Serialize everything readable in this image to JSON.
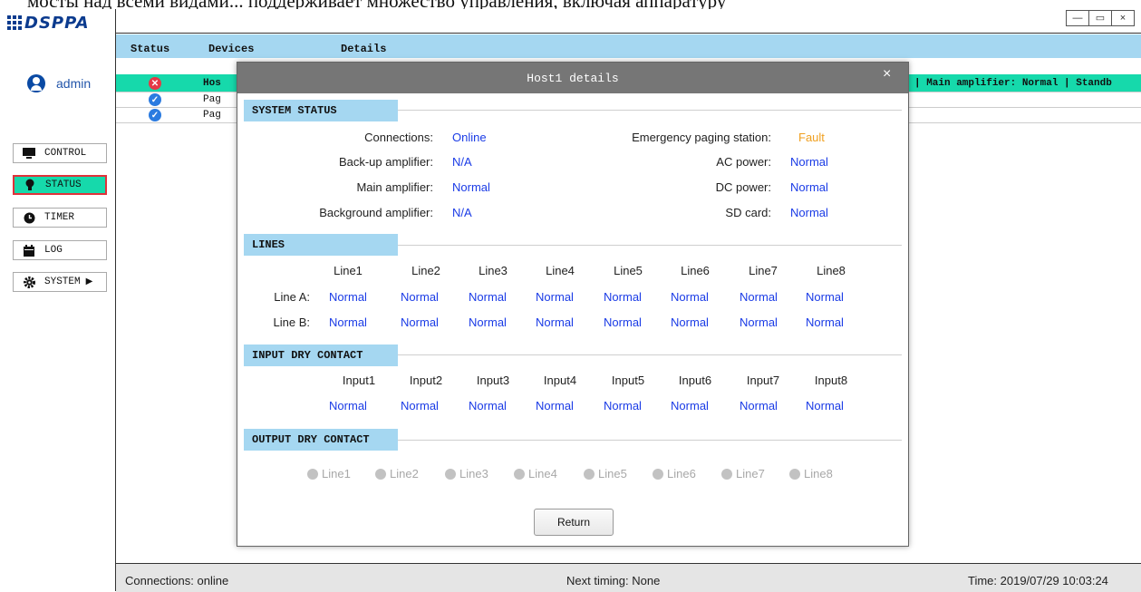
{
  "top_strip_text": "мосты над всеми видами... поддерживает множество управления, включая аппаратуру",
  "logo": "DSPPA",
  "window_controls": {
    "minimize": "—",
    "maximize": "▭",
    "close": "×"
  },
  "user": {
    "name": "admin"
  },
  "nav": [
    {
      "label": "CONTROL",
      "icon": "monitor-icon"
    },
    {
      "label": "STATUS",
      "icon": "lightbulb-icon",
      "active": true
    },
    {
      "label": "TIMER",
      "icon": "clock-icon"
    },
    {
      "label": "LOG",
      "icon": "calendar-icon"
    },
    {
      "label": "SYSTEM",
      "icon": "gear-icon",
      "arrow": "▶"
    }
  ],
  "table": {
    "headers": {
      "status": "Status",
      "devices": "Devices",
      "details": "Details"
    },
    "rows": [
      {
        "status": "error",
        "device": "Hos",
        "details": "| Main amplifier: Normal | Standb"
      },
      {
        "status": "ok",
        "device": "Pag",
        "details": ""
      },
      {
        "status": "ok",
        "device": "Pag",
        "details": ""
      }
    ]
  },
  "modal": {
    "title": "Host1 details",
    "close": "×",
    "system_status": {
      "heading": "SYSTEM STATUS",
      "left": [
        {
          "label": "Connections:",
          "value": "Online"
        },
        {
          "label": "Back-up amplifier:",
          "value": "N/A"
        },
        {
          "label": "Main amplifier:",
          "value": "Normal"
        },
        {
          "label": "Background amplifier:",
          "value": "N/A"
        }
      ],
      "right": [
        {
          "label": "Emergency paging station:",
          "value": "Fault"
        },
        {
          "label": "AC power:",
          "value": "Normal"
        },
        {
          "label": "DC power:",
          "value": "Normal"
        },
        {
          "label": "SD card:",
          "value": "Normal"
        }
      ]
    },
    "lines": {
      "heading": "LINES",
      "columns": [
        "Line1",
        "Line2",
        "Line3",
        "Line4",
        "Line5",
        "Line6",
        "Line7",
        "Line8"
      ],
      "rows": [
        {
          "label": "Line A:",
          "values": [
            "Normal",
            "Normal",
            "Normal",
            "Normal",
            "Normal",
            "Normal",
            "Normal",
            "Normal"
          ]
        },
        {
          "label": "Line B:",
          "values": [
            "Normal",
            "Normal",
            "Normal",
            "Normal",
            "Normal",
            "Normal",
            "Normal",
            "Normal"
          ]
        }
      ]
    },
    "input_dry_contact": {
      "heading": "INPUT DRY CONTACT",
      "columns": [
        "Input1",
        "Input2",
        "Input3",
        "Input4",
        "Input5",
        "Input6",
        "Input7",
        "Input8"
      ],
      "values": [
        "Normal",
        "Normal",
        "Normal",
        "Normal",
        "Normal",
        "Normal",
        "Normal",
        "Normal"
      ]
    },
    "output_dry_contact": {
      "heading": "OUTPUT DRY CONTACT",
      "items": [
        "Line1",
        "Line2",
        "Line3",
        "Line4",
        "Line5",
        "Line6",
        "Line7",
        "Line8"
      ]
    },
    "return_label": "Return"
  },
  "status_bar": {
    "connections": "Connections: online",
    "next_timing": "Next timing: None",
    "time": "Time: 2019/07/29  10:03:24"
  },
  "colors": {
    "accent_teal": "#16d9ab",
    "header_blue": "#a5d7f1",
    "value_blue": "#1a3be6",
    "fault": "#f0a020"
  }
}
